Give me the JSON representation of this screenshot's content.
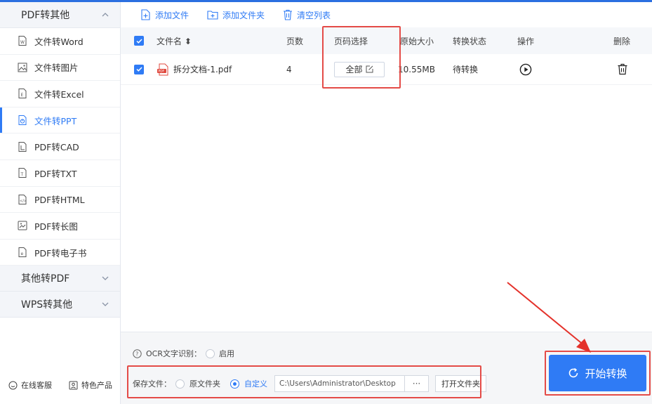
{
  "sidebar": {
    "group_pdf_to_other": "PDF转其他",
    "items": [
      {
        "label": "文件转Word",
        "icon": "word-file-icon"
      },
      {
        "label": "文件转图片",
        "icon": "image-file-icon"
      },
      {
        "label": "文件转Excel",
        "icon": "excel-file-icon"
      },
      {
        "label": "文件转PPT",
        "icon": "ppt-file-icon"
      },
      {
        "label": "PDF转CAD",
        "icon": "cad-file-icon"
      },
      {
        "label": "PDF转TXT",
        "icon": "txt-file-icon"
      },
      {
        "label": "PDF转HTML",
        "icon": "html-file-icon"
      },
      {
        "label": "PDF转长图",
        "icon": "long-image-icon"
      },
      {
        "label": "PDF转电子书",
        "icon": "ebook-file-icon"
      }
    ],
    "active_index": 3,
    "group_other_to_pdf": "其他转PDF",
    "group_wps_to_other": "WPS转其他",
    "footer": {
      "support": "在线客服",
      "featured": "特色产品"
    }
  },
  "toolbar": {
    "add_file": "添加文件",
    "add_folder": "添加文件夹",
    "clear_list": "清空列表"
  },
  "table": {
    "headers": {
      "filename": "文件名 ⬍",
      "pages": "页数",
      "page_select": "页码选择",
      "size": "原始大小",
      "status": "转换状态",
      "action": "操作",
      "delete": "删除"
    },
    "rows": [
      {
        "filename": "拆分文档-1.pdf",
        "pages": "4",
        "page_select": "全部",
        "size": "10.55MB",
        "status": "待转换"
      }
    ]
  },
  "bottom": {
    "ocr_label": "OCR文字识别：",
    "ocr_option": "启用",
    "save_label": "保存文件：",
    "option_original": "原文件夹",
    "option_custom": "自定义",
    "path": "C:\\Users\\Administrator\\Desktop",
    "dots": "···",
    "open_folder": "打开文件夹",
    "start": "开始转换"
  },
  "colors": {
    "accent": "#2f7bf5",
    "highlight": "#e44b47"
  }
}
